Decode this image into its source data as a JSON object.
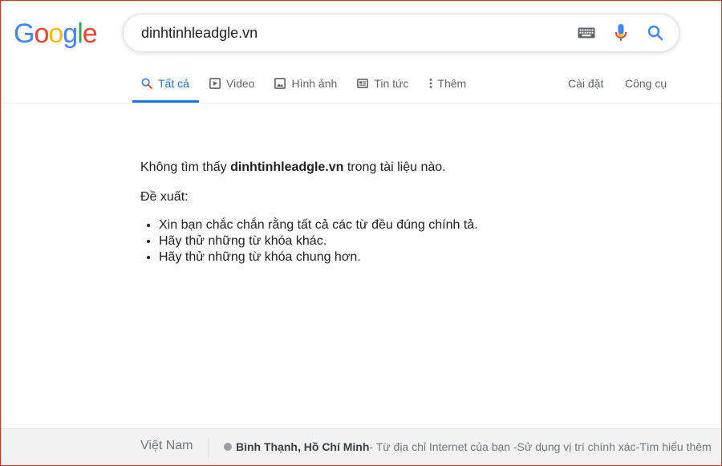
{
  "logo": {
    "letters": [
      {
        "char": "G",
        "color": "#4285F4"
      },
      {
        "char": "o",
        "color": "#EA4335"
      },
      {
        "char": "o",
        "color": "#FBBC05"
      },
      {
        "char": "g",
        "color": "#4285F4"
      },
      {
        "char": "l",
        "color": "#34A853"
      },
      {
        "char": "e",
        "color": "#EA4335"
      }
    ]
  },
  "search": {
    "value": "dinhtinhleadgle.vn",
    "keyboard_icon": "keyboard-icon",
    "mic_icon": "microphone-icon",
    "search_icon": "search-icon"
  },
  "tabs": [
    {
      "label": "Tất cả",
      "icon": "search-icon",
      "active": true
    },
    {
      "label": "Video",
      "icon": "play-icon",
      "active": false
    },
    {
      "label": "Hình ảnh",
      "icon": "image-icon",
      "active": false
    },
    {
      "label": "Tin tức",
      "icon": "news-icon",
      "active": false
    },
    {
      "label": "Thêm",
      "icon": "more-vertical-icon",
      "active": false
    }
  ],
  "tools": {
    "settings": "Cài đặt",
    "tools": "Công cụ"
  },
  "results": {
    "no_results_prefix": "Không tìm thấy ",
    "query": "dinhtinhleadgle.vn",
    "no_results_suffix": " trong tài liệu nào.",
    "suggestions_title": "Đề xuất:",
    "suggestions": [
      "Xin bạn chắc chắn rằng tất cả các từ đều đúng chính tả.",
      "Hãy thử những từ khóa khác.",
      "Hãy thử những từ khóa chung hơn."
    ]
  },
  "footer": {
    "country": "Việt Nam",
    "location": "Bình Thạnh, Hồ Chí Minh",
    "location_source": " - Từ địa chỉ Internet của bạn - ",
    "precise_location": "Sử dụng vị trí chính xác",
    "separator": " - ",
    "learn_more": "Tìm hiểu thêm"
  },
  "colors": {
    "accent": "#1a73e8",
    "text": "#202124",
    "muted": "#5f6368",
    "footer_bg": "#f2f2f2",
    "frame_border": "#d93025"
  }
}
